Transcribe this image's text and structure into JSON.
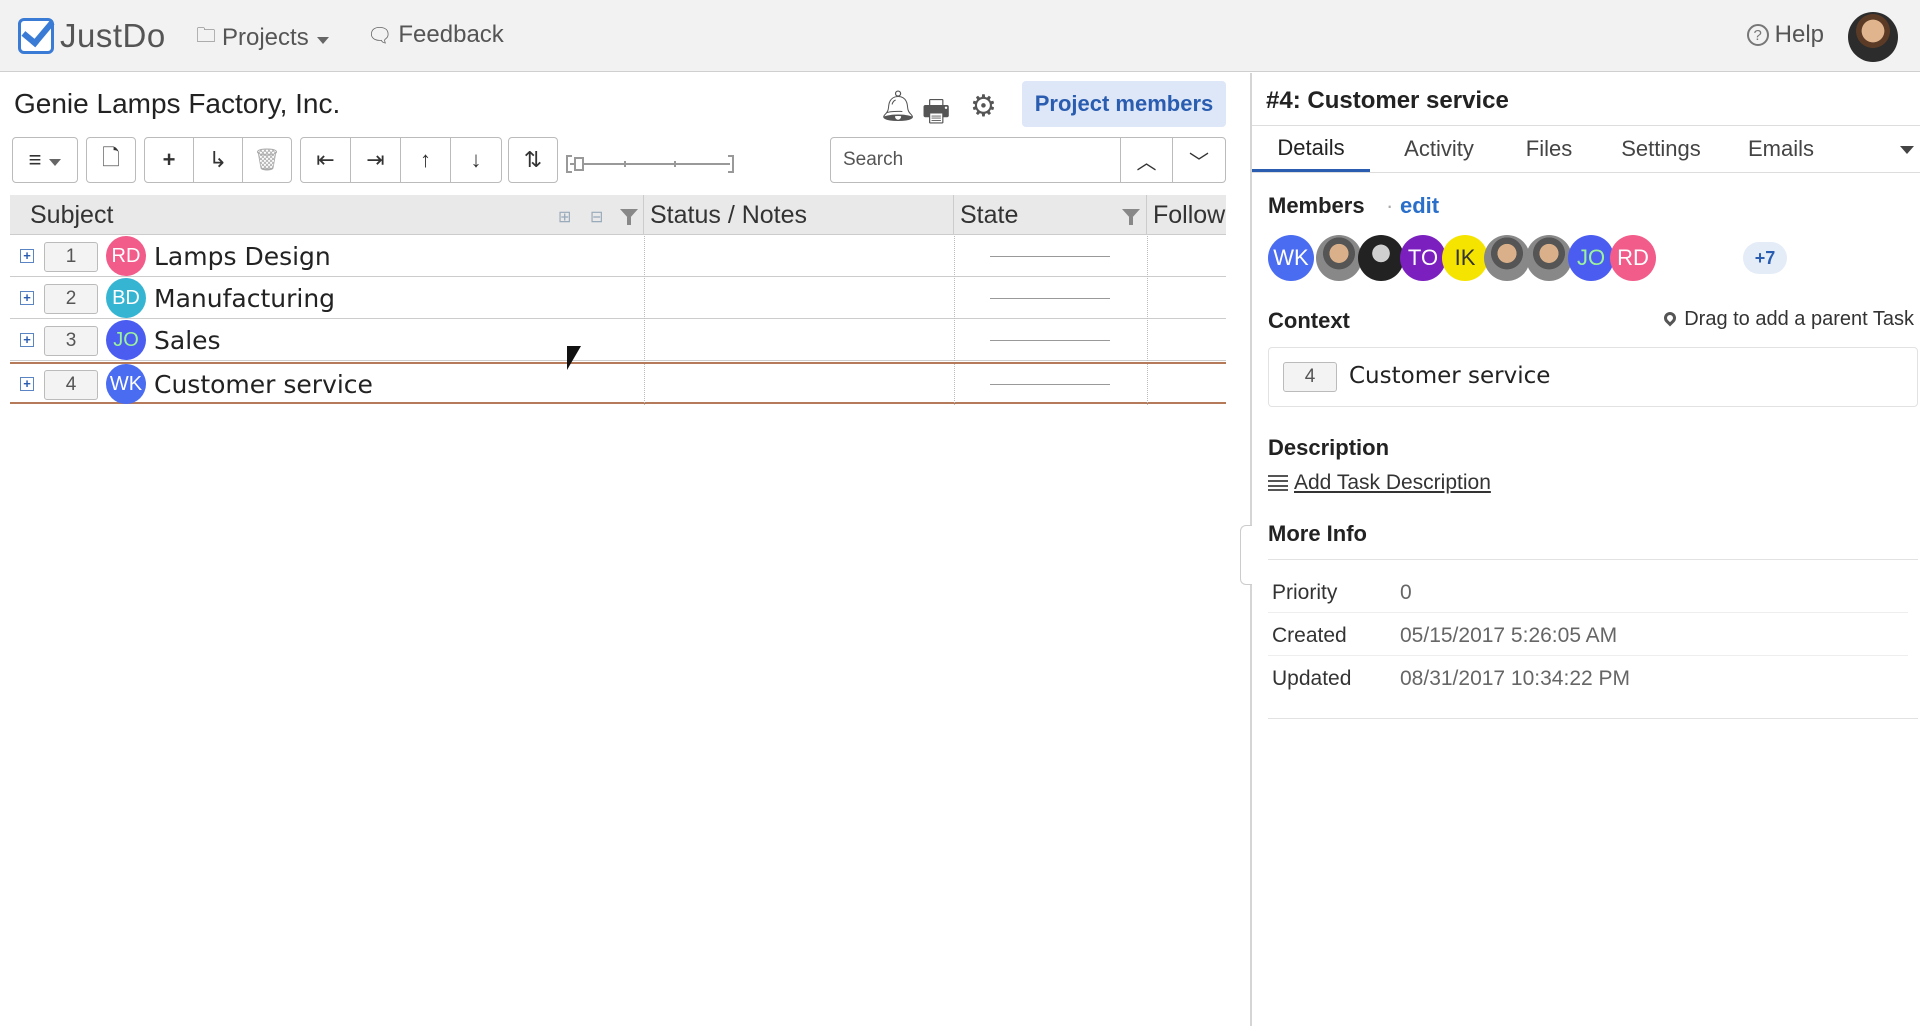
{
  "app": {
    "logo_text": "JustDo"
  },
  "topbar": {
    "projects_label": "Projects",
    "feedback_label": "Feedback",
    "help_label": "Help"
  },
  "project": {
    "title": "Genie Lamps Factory, Inc.",
    "members_button": "Project members"
  },
  "toolbar": {
    "search_placeholder": "Search"
  },
  "grid": {
    "columns": [
      "Subject",
      "Status / Notes",
      "State",
      "Follow"
    ],
    "rows": [
      {
        "seq": "1",
        "initials": "RD",
        "color": "#f25c8a",
        "subject": "Lamps Design"
      },
      {
        "seq": "2",
        "initials": "BD",
        "color": "#36b5d3",
        "subject": "Manufacturing"
      },
      {
        "seq": "3",
        "initials": "JO",
        "color": "#4a5df0",
        "subject": "Sales"
      },
      {
        "seq": "4",
        "initials": "WK",
        "color": "#4a6cf0",
        "subject": "Customer service"
      }
    ]
  },
  "task": {
    "title": "#4: Customer service",
    "tabs": [
      "Details",
      "Activity",
      "Files",
      "Settings",
      "Emails"
    ],
    "members_label": "Members",
    "members_dot": "·",
    "members_edit": "edit",
    "members": [
      {
        "initials": "WK",
        "color": "#4a6cf0"
      },
      {
        "initials": "",
        "photo": true
      },
      {
        "initials": "",
        "photo": true,
        "dark": true
      },
      {
        "initials": "TO",
        "color": "#7b1fbf"
      },
      {
        "initials": "IK",
        "color": "#f5e400",
        "text_color": "#333"
      },
      {
        "initials": "",
        "photo": true
      },
      {
        "initials": "",
        "photo": true
      },
      {
        "initials": "JO",
        "color": "#4a5df0"
      },
      {
        "initials": "RD",
        "color": "#f25c8a"
      }
    ],
    "members_more": "+7",
    "context_label": "Context",
    "drag_parent": "Drag to add a parent Task",
    "context_seq": "4",
    "context_name": "Customer service",
    "description_label": "Description",
    "add_description": "Add Task Description",
    "more_info_label": "More Info",
    "info": [
      {
        "key": "Priority",
        "value": "0"
      },
      {
        "key": "Created",
        "value": "05/15/2017 5:26:05 AM"
      },
      {
        "key": "Updated",
        "value": "08/31/2017 10:34:22 PM"
      }
    ]
  }
}
